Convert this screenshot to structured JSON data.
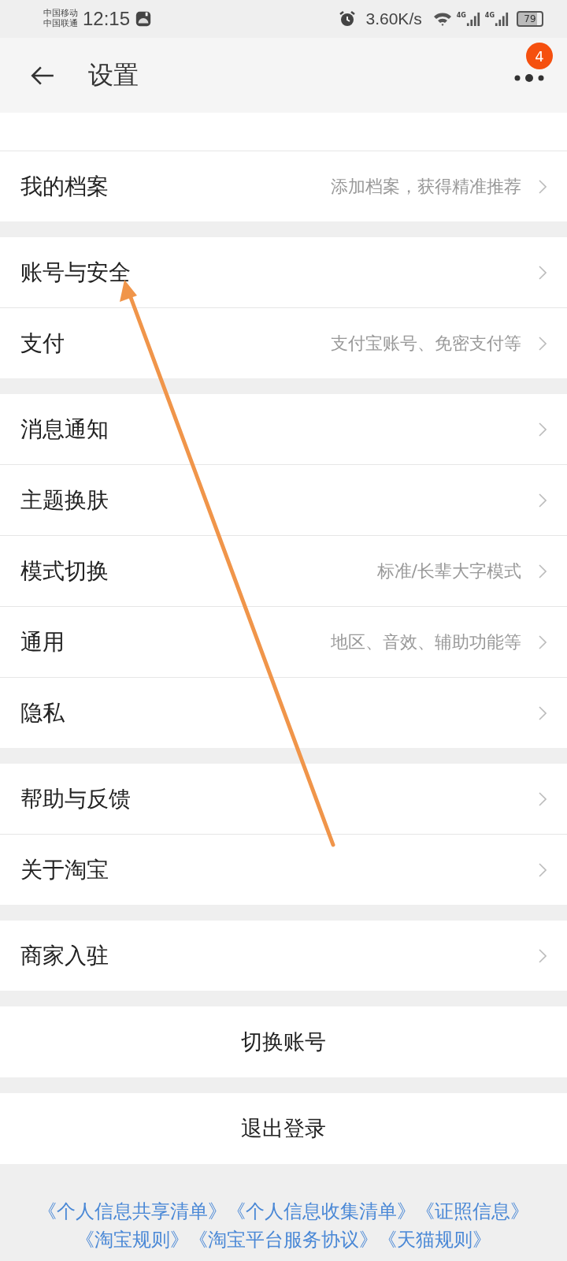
{
  "status_bar": {
    "carriers": [
      "中国移动",
      "中国联通"
    ],
    "time": "12:15",
    "speed": "3.60K/s",
    "network_1": "4G",
    "network_2": "4G",
    "battery": "79"
  },
  "header": {
    "title": "设置",
    "badge": "4"
  },
  "groups": [
    {
      "rows": [
        {
          "label": "我的档案",
          "hint": "添加档案，获得精准推荐"
        }
      ]
    },
    {
      "rows": [
        {
          "label": "账号与安全"
        },
        {
          "label": "支付",
          "hint": "支付宝账号、免密支付等"
        }
      ]
    },
    {
      "rows": [
        {
          "label": "消息通知"
        },
        {
          "label": "主题换肤"
        },
        {
          "label": "模式切换",
          "hint": "标准/长辈大字模式"
        },
        {
          "label": "通用",
          "hint": "地区、音效、辅助功能等"
        },
        {
          "label": "隐私"
        }
      ]
    },
    {
      "rows": [
        {
          "label": "帮助与反馈"
        },
        {
          "label": "关于淘宝"
        }
      ]
    },
    {
      "rows": [
        {
          "label": "商家入驻"
        }
      ]
    }
  ],
  "buttons": [
    "切换账号",
    "退出登录"
  ],
  "footer_links": [
    [
      "《个人信息共享清单》",
      "《个人信息收集清单》",
      "《证照信息》"
    ],
    [
      "《淘宝规则》",
      "《淘宝平台服务协议》",
      "《天猫规则》"
    ]
  ]
}
